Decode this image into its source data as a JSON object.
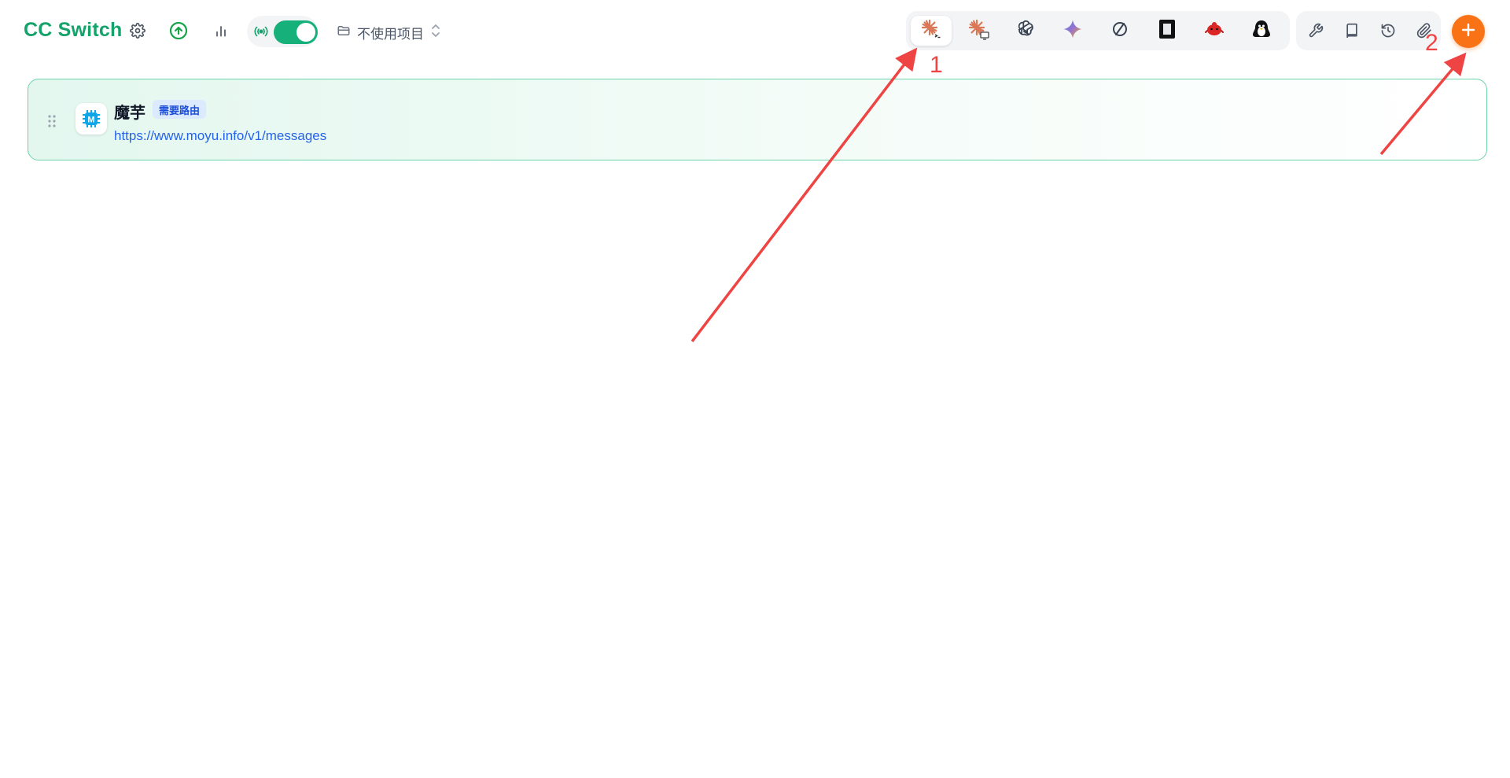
{
  "header": {
    "title": "CC Switch",
    "project_selector": {
      "label": "不使用项目"
    }
  },
  "icons": {
    "settings": "gear-icon",
    "update": "arrow-up-circle-icon",
    "usage": "bar-chart-icon",
    "proxy": "radio-signal-icon",
    "folder": "folder-icon",
    "chevron": "chevron-up-down-icon"
  },
  "app_switcher": [
    {
      "name": "claude-code",
      "active": true
    },
    {
      "name": "claude-desktop",
      "active": false
    },
    {
      "name": "openai-codex",
      "active": false
    },
    {
      "name": "gemini",
      "active": false
    },
    {
      "name": "opencode",
      "active": false
    },
    {
      "name": "terminal-app",
      "active": false
    },
    {
      "name": "red-creature-app",
      "active": false
    },
    {
      "name": "penguin-app",
      "active": false
    }
  ],
  "tools": [
    "wrench-icon",
    "book-icon",
    "history-icon",
    "paperclip-icon"
  ],
  "providers": [
    {
      "name": "魔芋",
      "badge": "需要路由",
      "url": "https://www.moyu.info/v1/messages",
      "logo_letter": "M"
    }
  ],
  "annotations": {
    "one": "1",
    "two": "2"
  },
  "colors": {
    "brand_green": "#16a36b",
    "toggle_on": "#16b07a",
    "add_button": "#f97316",
    "annotation_red": "#ef4444",
    "link_blue": "#2563eb"
  }
}
